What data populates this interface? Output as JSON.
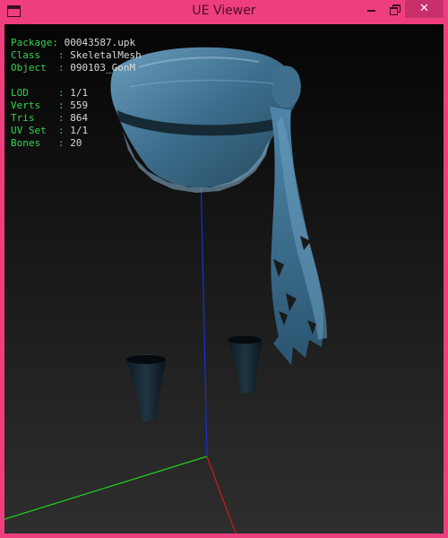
{
  "window": {
    "title": "UE Viewer",
    "controls": {
      "close": "✕"
    }
  },
  "info": {
    "rows": [
      {
        "key": "Package: ",
        "value": "00043587.upk"
      },
      {
        "key": "Class   : ",
        "value": "SkeletalMesh"
      },
      {
        "key": "Object  : ",
        "value": "090103_GonM"
      }
    ],
    "stats": [
      {
        "key": "LOD     : ",
        "value": "1/1"
      },
      {
        "key": "Verts   : ",
        "value": "559"
      },
      {
        "key": "Tris    : ",
        "value": "864"
      },
      {
        "key": "UV Set  : ",
        "value": "1/1"
      },
      {
        "key": "Bones   : ",
        "value": "20"
      }
    ]
  },
  "colors": {
    "frame": "#ee3e7e",
    "label": "#37d14f",
    "axis_x": "#d11a1a",
    "axis_y": "#1fd01f",
    "axis_z": "#1a2fd8",
    "mesh_main": "#3c6d8c",
    "mesh_dark": "#152a35"
  }
}
